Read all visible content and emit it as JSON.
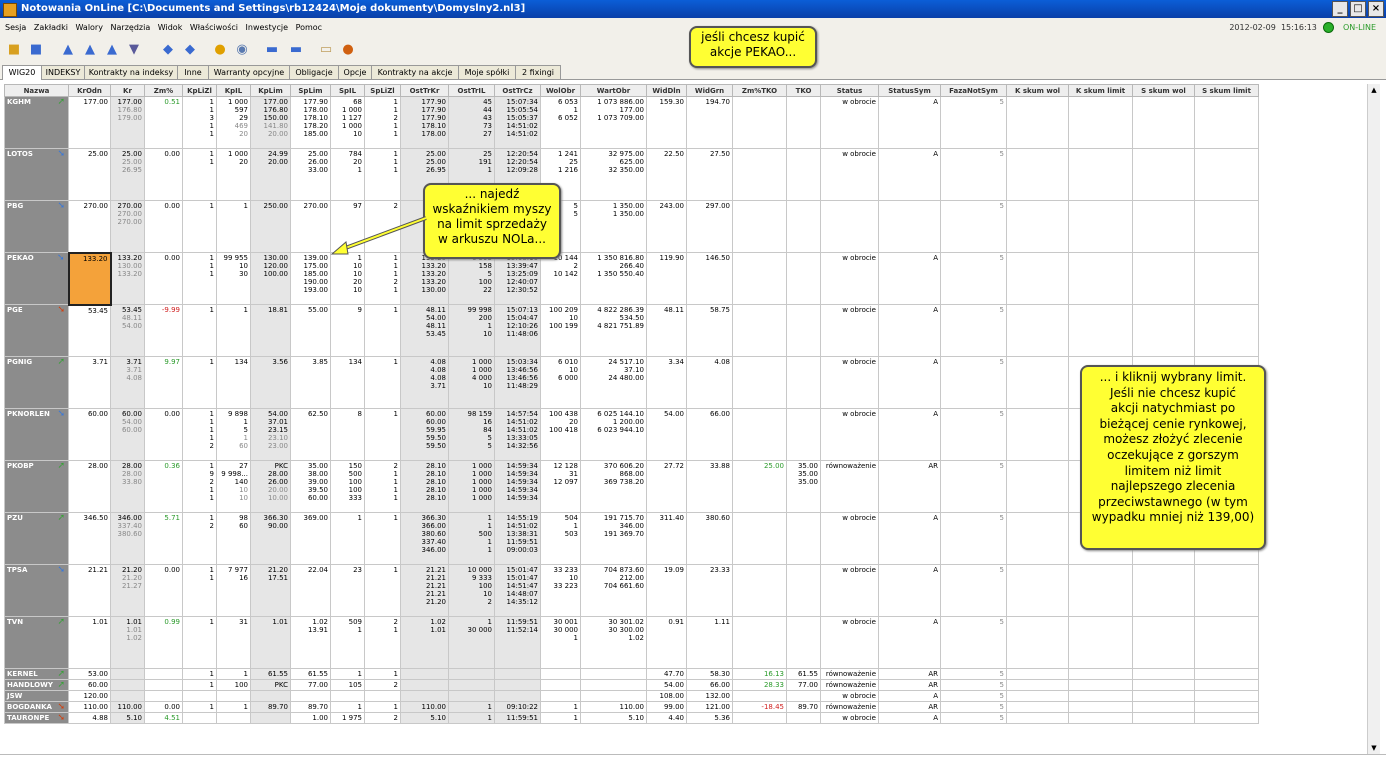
{
  "window": {
    "title": "Notowania OnLine [C:\\Documents and Settings\\rb12424\\Moje dokumenty\\Domyslny2.nl3]",
    "buttons": [
      "_",
      "□",
      "×"
    ]
  },
  "menu": [
    "Sesja",
    "Zakładki",
    "Walory",
    "Narzędzia",
    "Widok",
    "Właściwości",
    "Inwestycje",
    "Pomoc"
  ],
  "status": {
    "date": "2012-02-09",
    "time": "15:16:13",
    "connection": "ON-LINE"
  },
  "tabs": [
    "WIG20",
    "INDEKSY",
    "Kontrakty na indeksy",
    "Inne",
    "Warranty opcyjne",
    "Obligacje",
    "Opcje",
    "Kontrakty na akcje",
    "Moje spółki",
    "2 fixingi"
  ],
  "active_tab": "WIG20",
  "columns": [
    "Nazwa",
    "KrOdn",
    "Kr",
    "Zm%",
    "KpLiZl",
    "KpIL",
    "KpLim",
    "SpLim",
    "SpIL",
    "SpLiZl",
    "OstTrKr",
    "OstTrIL",
    "OstTrCz",
    "WolObr",
    "WartObr",
    "WidDln",
    "WidGrn",
    "Zm%TKO",
    "TKO",
    "Status",
    "StatusSym",
    "FazaNotSym",
    "K skum wol",
    "K skum limit",
    "S skum wol",
    "S skum limit"
  ],
  "rows": [
    {
      "name": "KGHM",
      "dir": "up",
      "krodn": "177.00",
      "kr": [
        "177.00",
        "176.80",
        "179.00"
      ],
      "zm": "0.51",
      "zmc": "pos",
      "kpliz": [
        "1",
        "1",
        "3",
        "1",
        "1"
      ],
      "kpil": [
        "1 000",
        "597",
        "29",
        "469",
        "20"
      ],
      "kplim": [
        "177.00",
        "176.80",
        "150.00",
        "141.80",
        "20.00"
      ],
      "splim": [
        "177.90",
        "178.00",
        "178.10",
        "178.20",
        "185.00"
      ],
      "spil": [
        "68",
        "1 000",
        "1 127",
        "1 000",
        "10"
      ],
      "spliz": [
        "1",
        "1",
        "2",
        "1",
        "1"
      ],
      "ostkr": [
        "177.90",
        "177.90",
        "177.90",
        "178.10",
        "178.00"
      ],
      "ostil": [
        "45",
        "44",
        "43",
        "73",
        "27"
      ],
      "ostcz": [
        "15:07:34",
        "15:05:54",
        "15:05:37",
        "14:51:02",
        "14:51:02"
      ],
      "wol": [
        "6 053",
        "1",
        "6 052"
      ],
      "wart": [
        "1 073 886.00",
        "177.00",
        "1 073 709.00"
      ],
      "wdl": "159.30",
      "wgr": "194.70",
      "zmtko": "",
      "tko": [],
      "status": "w obrocie",
      "ss": "A",
      "fz": "5"
    },
    {
      "name": "LOTOS",
      "dir": "dn",
      "krodn": "25.00",
      "kr": [
        "25.00",
        "25.00",
        "26.95"
      ],
      "zm": "0.00",
      "zmc": "",
      "kpliz": [
        "1",
        "1"
      ],
      "kpil": [
        "1 000",
        "20"
      ],
      "kplim": [
        "24.99",
        "20.00"
      ],
      "splim": [
        "25.00",
        "26.00",
        "33.00"
      ],
      "spil": [
        "784",
        "20",
        "1"
      ],
      "spliz": [
        "1",
        "1",
        "1"
      ],
      "ostkr": [
        "25.00",
        "25.00",
        "26.95"
      ],
      "ostil": [
        "25",
        "191",
        "1"
      ],
      "ostcz": [
        "12:20:54",
        "12:20:54",
        "12:09:28"
      ],
      "wol": [
        "1 241",
        "25",
        "1 216"
      ],
      "wart": [
        "32 975.00",
        "625.00",
        "32 350.00"
      ],
      "wdl": "22.50",
      "wgr": "27.50",
      "zmtko": "",
      "tko": [],
      "status": "w obrocie",
      "ss": "A",
      "fz": "5"
    },
    {
      "name": "PBG",
      "dir": "dn",
      "krodn": "270.00",
      "kr": [
        "270.00",
        "270.00",
        "270.00"
      ],
      "zm": "0.00",
      "zmc": "",
      "kpliz": [
        "1"
      ],
      "kpil": [
        "1"
      ],
      "kplim": [
        "250.00"
      ],
      "splim": [
        "270.00"
      ],
      "spil": [
        "97"
      ],
      "spliz": [
        "2"
      ],
      "ostkr": [],
      "ostil": [],
      "ostcz": [],
      "wol": [
        "5",
        "5"
      ],
      "wart": [
        "1 350.00",
        "1 350.00"
      ],
      "wdl": "243.00",
      "wgr": "297.00",
      "zmtko": "",
      "tko": [],
      "status": "",
      "ss": "",
      "fz": "5"
    },
    {
      "name": "PEKAO",
      "dir": "dn",
      "krodn": "133.20",
      "kr": [
        "133.20",
        "130.00",
        "133.20"
      ],
      "zm": "0.00",
      "zmc": "",
      "kpliz": [
        "1",
        "1",
        "1"
      ],
      "kpil": [
        "99 955",
        "10",
        "30"
      ],
      "kplim": [
        "130.00",
        "120.00",
        "100.00"
      ],
      "splim": [
        "139.00",
        "175.00",
        "185.00",
        "190.00",
        "193.00"
      ],
      "spil": [
        "1",
        "10",
        "10",
        "20",
        "10"
      ],
      "spliz": [
        "1",
        "1",
        "1",
        "2",
        "1"
      ],
      "ostkr": [
        "133.20",
        "133.20",
        "133.20",
        "133.20",
        "130.00"
      ],
      "ostil": [
        "6 593",
        "158",
        "5",
        "100",
        "22"
      ],
      "ostcz": [
        "15:08:16",
        "13:39:47",
        "13:25:09",
        "12:40:07",
        "12:30:52"
      ],
      "wol": [
        "10 144",
        "2",
        "10 142"
      ],
      "wart": [
        "1 350 816.80",
        "266.40",
        "1 350 550.40"
      ],
      "wdl": "119.90",
      "wgr": "146.50",
      "zmtko": "",
      "tko": [],
      "status": "w obrocie",
      "ss": "A",
      "fz": "5"
    },
    {
      "name": "PGE",
      "dir": "neg",
      "krodn": "53.45",
      "kr": [
        "53.45",
        "48.11",
        "54.00"
      ],
      "zm": "-9.99",
      "zmc": "neg",
      "kpliz": [
        "1"
      ],
      "kpil": [
        "1"
      ],
      "kplim": [
        "18.81"
      ],
      "splim": [
        "55.00"
      ],
      "spil": [
        "9"
      ],
      "spliz": [
        "1"
      ],
      "ostkr": [
        "48.11",
        "54.00",
        "48.11",
        "53.45"
      ],
      "ostil": [
        "99 998",
        "200",
        "1",
        "10"
      ],
      "ostcz": [
        "15:07:13",
        "15:04:47",
        "12:10:26",
        "11:48:06"
      ],
      "wol": [
        "100 209",
        "10",
        "100 199"
      ],
      "wart": [
        "4 822 286.39",
        "534.50",
        "4 821 751.89"
      ],
      "wdl": "48.11",
      "wgr": "58.75",
      "zmtko": "",
      "tko": [],
      "status": "w obrocie",
      "ss": "A",
      "fz": "5"
    },
    {
      "name": "PGNIG",
      "dir": "up",
      "krodn": "3.71",
      "kr": [
        "3.71",
        "3.71",
        "4.08"
      ],
      "zm": "9.97",
      "zmc": "pos",
      "kpliz": [
        "1"
      ],
      "kpil": [
        "134"
      ],
      "kplim": [
        "3.56"
      ],
      "splim": [
        "3.85"
      ],
      "spil": [
        "134"
      ],
      "spliz": [
        "1"
      ],
      "ostkr": [
        "4.08",
        "4.08",
        "4.08",
        "3.71"
      ],
      "ostil": [
        "1 000",
        "1 000",
        "4 000",
        "10"
      ],
      "ostcz": [
        "15:03:34",
        "13:46:56",
        "13:46:56",
        "11:48:29"
      ],
      "wol": [
        "6 010",
        "10",
        "6 000"
      ],
      "wart": [
        "24 517.10",
        "37.10",
        "24 480.00"
      ],
      "wdl": "3.34",
      "wgr": "4.08",
      "zmtko": "",
      "tko": [],
      "status": "w obrocie",
      "ss": "A",
      "fz": "5"
    },
    {
      "name": "PKNORLEN",
      "dir": "dn",
      "krodn": "60.00",
      "kr": [
        "60.00",
        "54.00",
        "60.00"
      ],
      "zm": "0.00",
      "zmc": "",
      "kpliz": [
        "1",
        "1",
        "1",
        "1",
        "2"
      ],
      "kpil": [
        "9 898",
        "1",
        "5",
        "1",
        "60"
      ],
      "kplim": [
        "54.00",
        "37.01",
        "23.15",
        "23.10",
        "23.00"
      ],
      "splim": [
        "62.50"
      ],
      "spil": [
        "8"
      ],
      "spliz": [
        "1"
      ],
      "ostkr": [
        "60.00",
        "60.00",
        "59.95",
        "59.50",
        "59.50"
      ],
      "ostil": [
        "98 159",
        "16",
        "84",
        "5",
        "5"
      ],
      "ostcz": [
        "14:57:54",
        "14:51:02",
        "14:51:02",
        "13:33:05",
        "14:32:56"
      ],
      "wol": [
        "100 438",
        "20",
        "100 418"
      ],
      "wart": [
        "6 025 144.10",
        "1 200.00",
        "6 023 944.10"
      ],
      "wdl": "54.00",
      "wgr": "66.00",
      "zmtko": "",
      "tko": [],
      "status": "w obrocie",
      "ss": "A",
      "fz": "5"
    },
    {
      "name": "PKOBP",
      "dir": "up",
      "krodn": "28.00",
      "kr": [
        "28.00",
        "28.00",
        "33.80"
      ],
      "zm": "0.36",
      "zmc": "pos",
      "kpliz": [
        "1",
        "9",
        "2",
        "1",
        "1"
      ],
      "kpil": [
        "27",
        "9 998...",
        "140",
        "10",
        "10"
      ],
      "kplim": [
        "PKC",
        "28.00",
        "26.00",
        "20.00",
        "10.00"
      ],
      "splim": [
        "35.00",
        "38.00",
        "39.00",
        "39.50",
        "60.00"
      ],
      "spil": [
        "150",
        "500",
        "100",
        "100",
        "333"
      ],
      "spliz": [
        "2",
        "1",
        "1",
        "1",
        "1"
      ],
      "ostkr": [
        "28.10",
        "28.10",
        "28.10",
        "28.10",
        "28.10"
      ],
      "ostil": [
        "1 000",
        "1 000",
        "1 000",
        "1 000",
        "1 000"
      ],
      "ostcz": [
        "14:59:34",
        "14:59:34",
        "14:59:34",
        "14:59:34",
        "14:59:34"
      ],
      "wol": [
        "12 128",
        "31",
        "12 097"
      ],
      "wart": [
        "370 606.20",
        "868.00",
        "369 738.20"
      ],
      "wdl": "27.72",
      "wgr": "33.88",
      "zmtko": "25.00",
      "tko": [
        "35.00",
        "35.00",
        "35.00"
      ],
      "status": "równoważenie",
      "ss": "AR",
      "fz": "5"
    },
    {
      "name": "PZU",
      "dir": "up",
      "krodn": "346.50",
      "kr": [
        "346.00",
        "337.40",
        "380.60"
      ],
      "zm": "5.71",
      "zmc": "pos",
      "kpliz": [
        "1",
        "2"
      ],
      "kpil": [
        "98",
        "60"
      ],
      "kplim": [
        "366.30",
        "90.00"
      ],
      "splim": [
        "369.00"
      ],
      "spil": [
        "1"
      ],
      "spliz": [
        "1"
      ],
      "ostkr": [
        "366.30",
        "366.00",
        "380.60",
        "337.40",
        "346.00"
      ],
      "ostil": [
        "1",
        "1",
        "500",
        "1",
        "1"
      ],
      "ostcz": [
        "14:55:19",
        "14:51:02",
        "13:38:31",
        "11:59:51",
        "09:00:03"
      ],
      "wol": [
        "504",
        "1",
        "503"
      ],
      "wart": [
        "191 715.70",
        "346.00",
        "191 369.70"
      ],
      "wdl": "311.40",
      "wgr": "380.60",
      "zmtko": "",
      "tko": [],
      "status": "w obrocie",
      "ss": "A",
      "fz": "5"
    },
    {
      "name": "TPSA",
      "dir": "dn",
      "krodn": "21.21",
      "kr": [
        "21.20",
        "21.20",
        "21.27"
      ],
      "zm": "0.00",
      "zmc": "",
      "kpliz": [
        "1",
        "1"
      ],
      "kpil": [
        "7 977",
        "16"
      ],
      "kplim": [
        "21.20",
        "17.51"
      ],
      "splim": [
        "22.04"
      ],
      "spil": [
        "23"
      ],
      "spliz": [
        "1"
      ],
      "ostkr": [
        "21.21",
        "21.21",
        "21.21",
        "21.21",
        "21.20"
      ],
      "ostil": [
        "10 000",
        "9 333",
        "100",
        "10",
        "2"
      ],
      "ostcz": [
        "15:01:47",
        "15:01:47",
        "14:51:47",
        "14:48:07",
        "14:35:12"
      ],
      "wol": [
        "33 233",
        "10",
        "33 223"
      ],
      "wart": [
        "704 873.60",
        "212.00",
        "704 661.60"
      ],
      "wdl": "19.09",
      "wgr": "23.33",
      "zmtko": "",
      "tko": [],
      "status": "w obrocie",
      "ss": "A",
      "fz": "5"
    },
    {
      "name": "TVN",
      "dir": "up",
      "krodn": "1.01",
      "kr": [
        "1.01",
        "1.01",
        "1.02"
      ],
      "zm": "0.99",
      "zmc": "pos",
      "kpliz": [
        "1"
      ],
      "kpil": [
        "31"
      ],
      "kplim": [
        "1.01"
      ],
      "splim": [
        "1.02",
        "13.91"
      ],
      "spil": [
        "509",
        "1"
      ],
      "spliz": [
        "2",
        "1"
      ],
      "ostkr": [
        "1.02",
        "1.01"
      ],
      "ostil": [
        "1",
        "30 000"
      ],
      "ostcz": [
        "11:59:51",
        "11:52:14"
      ],
      "wol": [
        "30 001",
        "30 000",
        "1"
      ],
      "wart": [
        "30 301.02",
        "30 300.00",
        "1.02"
      ],
      "wdl": "0.91",
      "wgr": "1.11",
      "zmtko": "",
      "tko": [],
      "status": "w obrocie",
      "ss": "A",
      "fz": "5"
    }
  ],
  "small_rows": [
    {
      "name": "KERNEL",
      "dir": "up",
      "krodn": "53.00",
      "kr": "",
      "zm": "",
      "zmc": "",
      "kpliz": "1",
      "kpil": "1",
      "kplim": "61.55",
      "splim": "61.55",
      "spil": "1",
      "spliz": "1",
      "ostkr": "",
      "ostil": "",
      "ostcz": "",
      "wol": "",
      "wart": "",
      "wdl": "47.70",
      "wgr": "58.30",
      "zmtko": "16.13",
      "tko": "61.55",
      "status": "równoważenie",
      "ss": "AR",
      "fz": "5"
    },
    {
      "name": "HANDLOWY",
      "dir": "up",
      "krodn": "60.00",
      "kr": "",
      "zm": "",
      "zmc": "",
      "kpliz": "1",
      "kpil": "100",
      "kplim": "PKC",
      "splim": "77.00",
      "spil": "105",
      "spliz": "2",
      "ostkr": "",
      "ostil": "",
      "ostcz": "",
      "wol": "",
      "wart": "",
      "wdl": "54.00",
      "wgr": "66.00",
      "zmtko": "28.33",
      "tko": "77.00",
      "status": "równoważenie",
      "ss": "AR",
      "fz": "5"
    },
    {
      "name": "JSW",
      "dir": "",
      "krodn": "120.00",
      "kr": "",
      "zm": "",
      "zmc": "",
      "kpliz": "",
      "kpil": "",
      "kplim": "",
      "splim": "",
      "spil": "",
      "spliz": "",
      "ostkr": "",
      "ostil": "",
      "ostcz": "",
      "wol": "",
      "wart": "",
      "wdl": "108.00",
      "wgr": "132.00",
      "zmtko": "",
      "tko": "",
      "status": "w obrocie",
      "ss": "A",
      "fz": "5"
    },
    {
      "name": "BOGDANKA",
      "dir": "neg",
      "krodn": "110.00",
      "kr": "110.00",
      "zm": "0.00",
      "zmc": "",
      "kpliz": "1",
      "kpil": "1",
      "kplim": "89.70",
      "splim": "89.70",
      "spil": "1",
      "spliz": "1",
      "ostkr": "110.00",
      "ostil": "1",
      "ostcz": "09:10:22",
      "wol": "1",
      "wart": "110.00",
      "wdl": "99.00",
      "wgr": "121.00",
      "zmtko": "-18.45",
      "tko": "89.70",
      "status": "równoważenie",
      "ss": "AR",
      "fz": "5"
    },
    {
      "name": "TAURONPE",
      "dir": "neg",
      "krodn": "4.88",
      "kr": "5.10",
      "zm": "4.51",
      "zmc": "pos",
      "kpliz": "",
      "kpil": "",
      "kplim": "",
      "splim": "1.00",
      "spil": "1 975",
      "spliz": "2",
      "ostkr": "5.10",
      "ostil": "1",
      "ostcz": "11:59:51",
      "wol": "1",
      "wart": "5.10",
      "wdl": "4.40",
      "wgr": "5.36",
      "zmtko": "",
      "tko": "",
      "status": "w obrocie",
      "ss": "A",
      "fz": "5"
    }
  ],
  "callouts": {
    "top": [
      "jeśli chcesz kupić",
      "akcje PEKAO..."
    ],
    "middle": [
      "... najedź",
      "wskaźnikiem myszy",
      "na limit sprzedaży",
      "w arkuszu NOLa..."
    ],
    "right": [
      "... i kliknij wybrany limit.",
      "Jeśli nie chcesz kupić",
      "akcji natychmiast po",
      "bieżącej cenie rynkowej,",
      "możesz złożyć zlecenie",
      "oczekujące z gorszym",
      "limitem niż limit",
      "najlepszego zlecenia",
      "przeciwstawnego (w tym",
      "wypadku mniej niż 139,00)"
    ]
  },
  "colors": {
    "title_bar": "#0a4fc4",
    "highlight": "#f4a23a",
    "callout": "#ffff33",
    "name_cell": "#8c8c8c"
  }
}
